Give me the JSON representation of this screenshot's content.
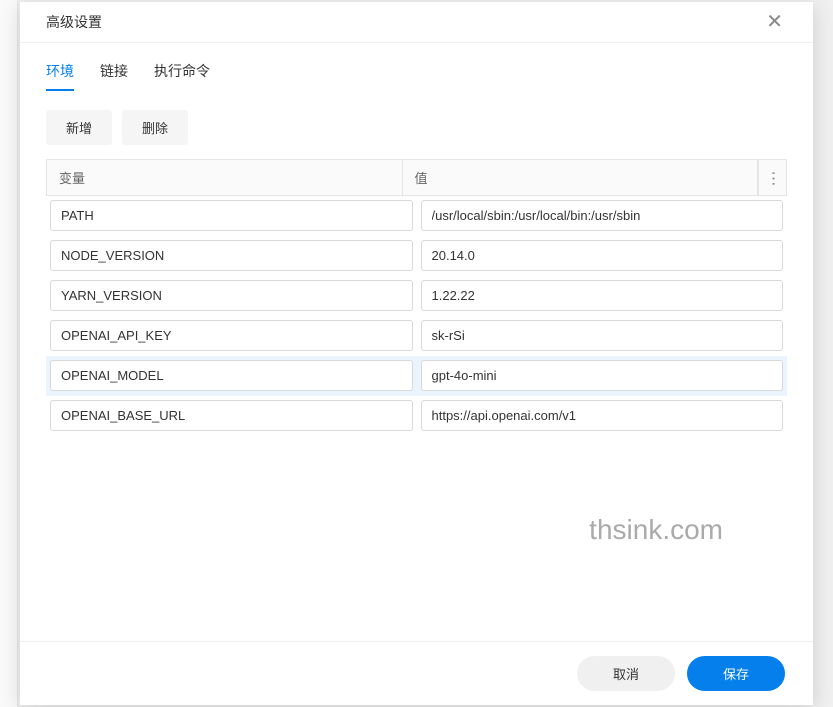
{
  "dialog": {
    "title": "高级设置",
    "tabs": [
      {
        "label": "环境",
        "active": true
      },
      {
        "label": "链接",
        "active": false
      },
      {
        "label": "执行命令",
        "active": false
      }
    ],
    "toolbar": {
      "add_label": "新增",
      "delete_label": "删除"
    },
    "grid": {
      "columns": [
        {
          "label": "变量"
        },
        {
          "label": "值"
        }
      ],
      "rows": [
        {
          "variable": "PATH",
          "value": "/usr/local/sbin:/usr/local/bin:/usr/sbin",
          "selected": false
        },
        {
          "variable": "NODE_VERSION",
          "value": "20.14.0",
          "selected": false
        },
        {
          "variable": "YARN_VERSION",
          "value": "1.22.22",
          "selected": false
        },
        {
          "variable": "OPENAI_API_KEY",
          "value": "sk-rSi",
          "selected": false
        },
        {
          "variable": "OPENAI_MODEL",
          "value": "gpt-4o-mini",
          "selected": true
        },
        {
          "variable": "OPENAI_BASE_URL",
          "value": "https://api.openai.com/v1",
          "selected": false
        }
      ]
    },
    "footer": {
      "cancel_label": "取消",
      "save_label": "保存"
    }
  },
  "watermark": "thsink.com"
}
